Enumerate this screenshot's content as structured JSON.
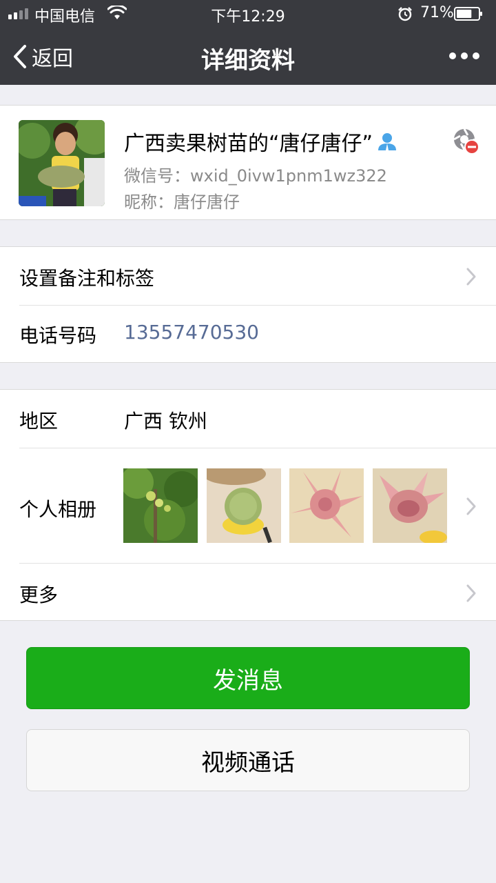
{
  "status_bar": {
    "carrier": "中国电信",
    "time": "下午12:29",
    "battery_percent": "71%",
    "battery_level": 0.71,
    "signal_bars_filled": 2,
    "signal_bars_total": 4
  },
  "nav": {
    "back_label": "返回",
    "title": "详细资料",
    "more_icon": "more-dots-icon"
  },
  "profile": {
    "name": "广西卖果树苗的“唐仔唐仔”",
    "wechat_id": "微信号：wxid_0ivw1pnm1wz322",
    "nickname": "昵称：唐仔唐仔",
    "badge_icon": "person-icon",
    "status_icon": "moments-blocked-icon"
  },
  "rows": {
    "remark": {
      "label": "设置备注和标签"
    },
    "phone": {
      "label": "电话号码",
      "value": "13557470530",
      "value_color": "#576b95"
    },
    "region": {
      "label": "地区",
      "value": "广西 钦州"
    },
    "album": {
      "label": "个人相册",
      "photos": [
        "pomelo-tree-photo",
        "pomelo-fruit-photo",
        "peeled-pomelo-photo",
        "peeled-pomelo-photo-2"
      ]
    },
    "more": {
      "label": "更多"
    }
  },
  "buttons": {
    "send_message": "发消息",
    "video_call": "视频通话"
  },
  "colors": {
    "header_bg": "#393a3f",
    "page_bg": "#efeff4",
    "primary_green": "#1aad19",
    "link_blue": "#576b95"
  }
}
